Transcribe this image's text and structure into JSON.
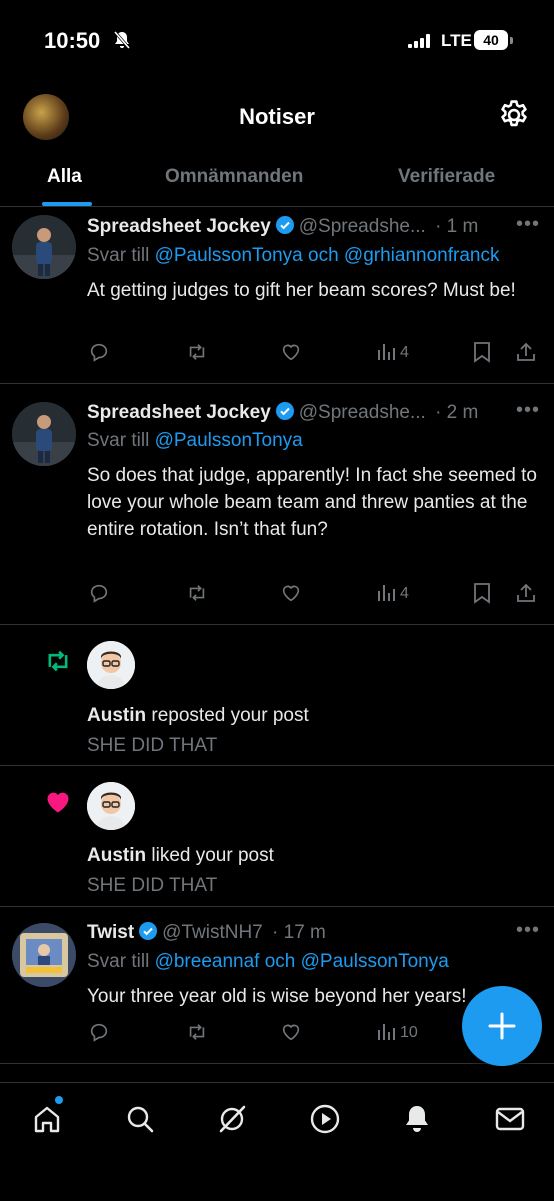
{
  "status": {
    "time": "10:50",
    "network": "LTE",
    "battery": "40"
  },
  "header": {
    "title": "Notiser",
    "tabs": [
      {
        "label": "Alla",
        "active": true
      },
      {
        "label": "Omnämnanden",
        "active": false
      },
      {
        "label": "Verifierade",
        "active": false
      }
    ]
  },
  "feed": [
    {
      "type": "reply",
      "name": "Spreadsheet Jockey",
      "handle": "@Spreadshe...",
      "time": "· 1 m",
      "reply_prefix": "Svar till ",
      "reply_to": "@PaulssonTonya och @grhiannonfranck",
      "text": "At getting judges to gift her beam scores?  Must be!",
      "views": "4"
    },
    {
      "type": "reply",
      "name": "Spreadsheet Jockey",
      "handle": "@Spreadshe...",
      "time": "· 2 m",
      "reply_prefix": "Svar till ",
      "reply_to": "@PaulssonTonya",
      "text": "So does that judge, apparently!  In fact she seemed to love your whole beam team and threw panties at the entire rotation.  Isn’t that fun?",
      "views": "4"
    },
    {
      "type": "repost",
      "user": "Austin",
      "action": " reposted your post",
      "post": "SHE DID THAT"
    },
    {
      "type": "like",
      "user": "Austin",
      "action": " liked your post",
      "post": "SHE DID THAT"
    },
    {
      "type": "reply",
      "name": "Twist",
      "handle": "@TwistNH7",
      "time": "· 17 m",
      "reply_prefix": "Svar till ",
      "reply_to": "@breeannaf och @PaulssonTonya",
      "text": "Your three year old is wise beyond her years!",
      "views": "10"
    }
  ],
  "colors": {
    "accent": "#1d9bf0",
    "repost": "#00ba7c",
    "like": "#f91880",
    "muted": "#71767b"
  },
  "tabbar": [
    "home-icon",
    "search-icon",
    "grok-icon",
    "video-icon",
    "notifications-icon",
    "messages-icon"
  ]
}
